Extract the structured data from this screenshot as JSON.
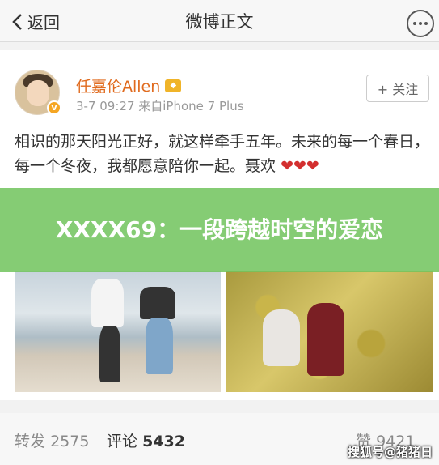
{
  "nav": {
    "back_label": "返回",
    "title": "微博正文"
  },
  "post": {
    "username": "任嘉伦Allen",
    "meta": "3-7 09:27  来自iPhone 7 Plus",
    "follow_label": "+ 关注",
    "text": "相识的那天阳光正好，就这样牵手五年。未来的每一个春日，每一个冬夜，我都愿意陪你一起。聂欢",
    "hearts": "❤❤❤"
  },
  "banner": {
    "title": "XXXX69：一段跨越时空的爱恋"
  },
  "stats": {
    "repost_label": "转发",
    "repost_count": "2575",
    "comment_label": "评论",
    "comment_count": "5432",
    "like_label": "赞",
    "like_count": "9421"
  },
  "watermark": "搜狐号@猪猪日",
  "colors": {
    "banner": "#71c45d",
    "username": "#e06b1f",
    "hearts": "#d32f2f"
  }
}
